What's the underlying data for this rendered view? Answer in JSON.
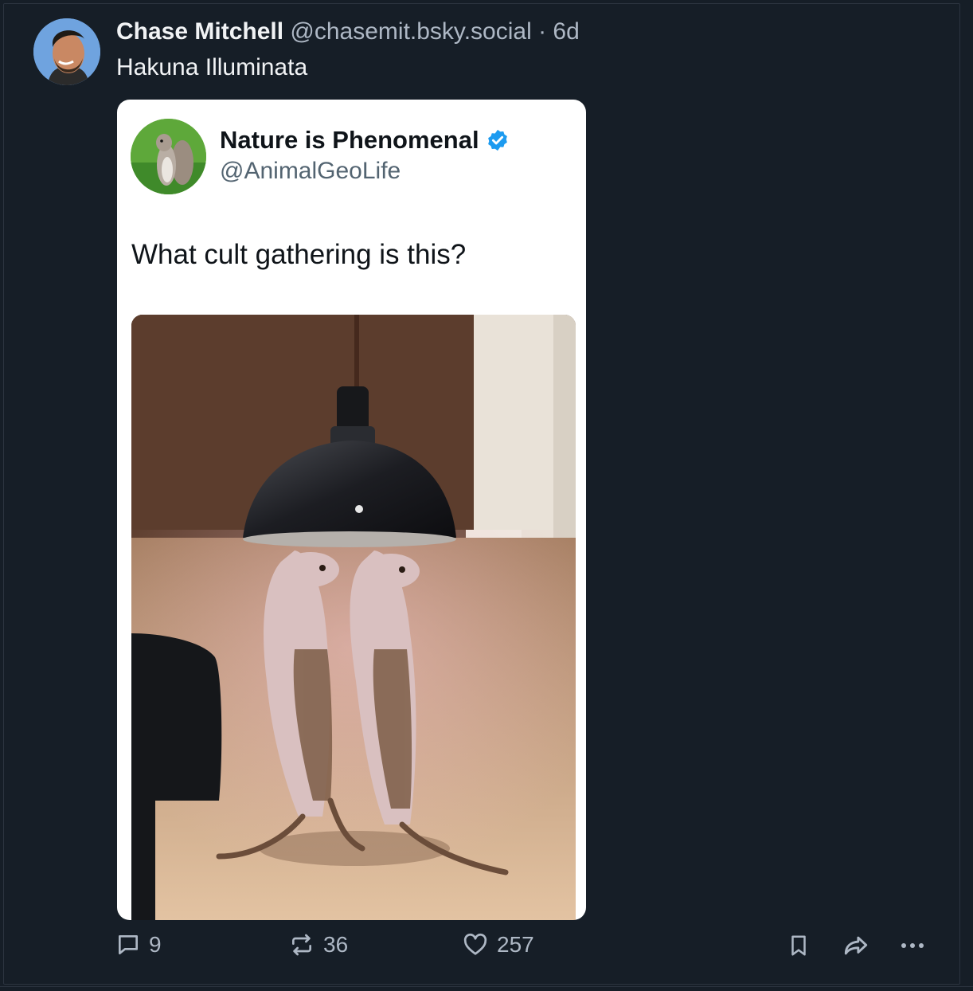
{
  "post": {
    "author_name": "Chase Mitchell",
    "author_handle": "@chasemit.bsky.social",
    "separator": "·",
    "time": "6d",
    "text": "Hakuna Illuminata"
  },
  "embed": {
    "name": "Nature is Phenomenal",
    "handle": "@AnimalGeoLife",
    "verified": true,
    "text": "What cult gathering is this?",
    "media_icon": "meerkats-under-heat-lamp-photo"
  },
  "actions": {
    "replies": "9",
    "reposts": "36",
    "likes": "257"
  },
  "colors": {
    "background": "#161e27",
    "text_primary": "#f1f3f5",
    "text_secondary": "#aeb8c5",
    "verified_blue": "#1d9bf0"
  }
}
